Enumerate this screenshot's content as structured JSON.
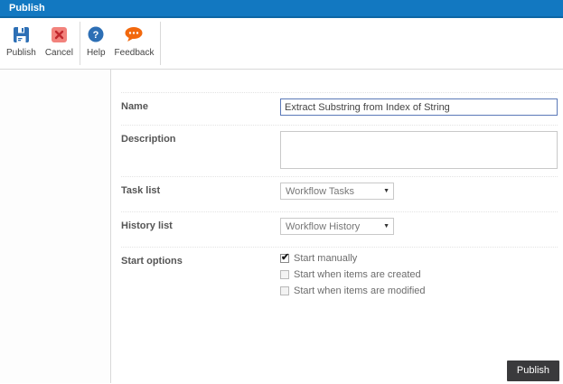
{
  "window": {
    "title": "Publish"
  },
  "toolbar": {
    "publish": {
      "label": "Publish"
    },
    "cancel": {
      "label": "Cancel"
    },
    "help": {
      "label": "Help"
    },
    "feedback": {
      "label": "Feedback"
    }
  },
  "form": {
    "name": {
      "label": "Name",
      "value": "Extract Substring from Index of String"
    },
    "description": {
      "label": "Description",
      "value": ""
    },
    "task_list": {
      "label": "Task list",
      "selected": "Workflow Tasks"
    },
    "history_list": {
      "label": "History list",
      "selected": "Workflow History"
    },
    "start_options": {
      "label": "Start options",
      "options": [
        {
          "label": "Start manually",
          "checked": true
        },
        {
          "label": "Start when items are created",
          "checked": false
        },
        {
          "label": "Start when items are modified",
          "checked": false
        }
      ]
    }
  },
  "footer": {
    "publish_label": "Publish"
  },
  "icons": {
    "save_icon": "floppy-disk",
    "cancel_icon": "red-x",
    "help_icon": "question-circle",
    "feedback_icon": "speech-bubble",
    "dropdown_arrow": "▼"
  },
  "colors": {
    "titlebar_blue": "#1278c1",
    "accent_blue": "#2d6fb5",
    "cancel_red": "#c1272d",
    "cancel_bg": "#f2827c",
    "feedback_orange": "#f2680d",
    "publish_button_bg": "#3a3a3c",
    "focused_input_border": "#5b79b8"
  }
}
